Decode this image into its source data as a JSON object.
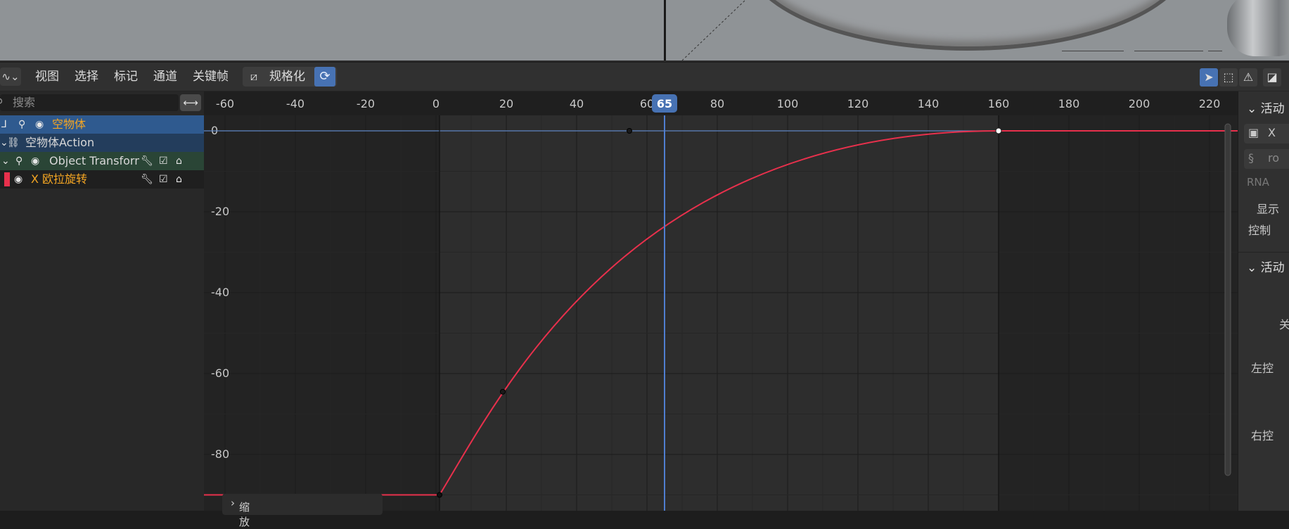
{
  "header": {
    "editor_type_icon": "graph-editor-icon",
    "menus": [
      "视图",
      "选择",
      "标记",
      "通道",
      "关键帧"
    ],
    "normalize_label": "规格化",
    "right_icons": [
      "select-arrow-icon",
      "box-select-icon",
      "warning-icon",
      "editor-toggle-icon"
    ]
  },
  "channels": {
    "search_placeholder": "搜索",
    "rows": [
      {
        "label": "空物体",
        "color": "#f5a623"
      },
      {
        "label": "空物体Action",
        "color": "#d8d8d8"
      },
      {
        "label": "Object Transform",
        "color": "#d8d8d8"
      },
      {
        "label": "X 欧拉旋转",
        "color": "#f5a623",
        "channel_color": "#e8304c"
      }
    ]
  },
  "graph": {
    "current_frame": "65",
    "x_ticks": [
      "-60",
      "-40",
      "-20",
      "0",
      "20",
      "40",
      "60",
      "80",
      "100",
      "120",
      "140",
      "160",
      "180",
      "200",
      "220"
    ],
    "y_ticks": [
      "0",
      "-20",
      "-40",
      "-60",
      "-80"
    ],
    "curve_color": "#e8304c",
    "keyframes": [
      {
        "frame": 1,
        "value": -90
      },
      {
        "frame": 160,
        "value": 0
      }
    ],
    "handles": [
      {
        "frame": 19,
        "value": -64.5
      },
      {
        "frame": 55,
        "value": 0
      }
    ],
    "zoom_panel_label": "缩放"
  },
  "sidebar": {
    "section1": "活动",
    "section2": "活动",
    "labels": [
      "X",
      "ro",
      "RNA",
      "显示",
      "控制",
      "关",
      "左控",
      "右控"
    ]
  }
}
